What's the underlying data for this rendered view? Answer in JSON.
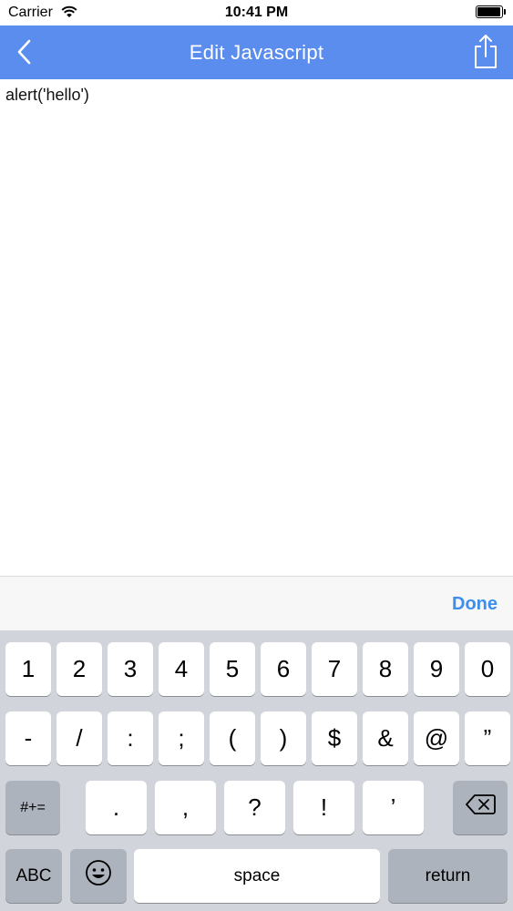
{
  "status_bar": {
    "carrier": "Carrier",
    "time": "10:41 PM"
  },
  "nav": {
    "title": "Edit Javascript",
    "back_icon": "chevron-left-icon",
    "share_icon": "share-icon",
    "background_color": "#5b8def"
  },
  "editor": {
    "content": "alert('hello')"
  },
  "accessory": {
    "done_label": "Done",
    "done_color": "#3d8ee8"
  },
  "keyboard": {
    "row1": [
      "1",
      "2",
      "3",
      "4",
      "5",
      "6",
      "7",
      "8",
      "9",
      "0"
    ],
    "row2": [
      "-",
      "/",
      ":",
      ";",
      "(",
      ")",
      "$",
      "&",
      "@",
      "”"
    ],
    "row3": {
      "mode_key": "#+=",
      "keys": [
        ".",
        ",",
        "?",
        "!",
        "’"
      ],
      "delete_icon": "backspace-icon"
    },
    "row4": {
      "abc_label": "ABC",
      "emoji_icon": "emoji-icon",
      "space_label": "space",
      "return_label": "return"
    }
  }
}
